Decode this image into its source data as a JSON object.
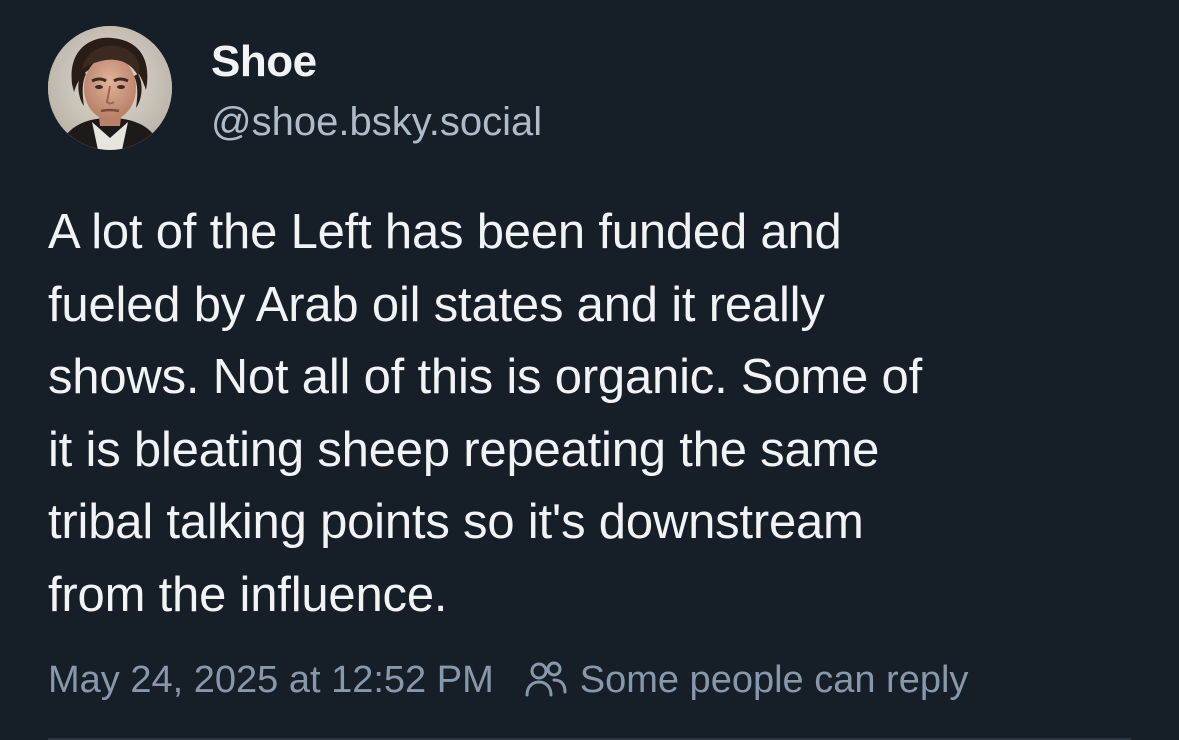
{
  "author": {
    "display_name": "Shoe",
    "handle": "@shoe.bsky.social",
    "avatar_icon": "avatar-portrait-icon"
  },
  "post": {
    "text_lines": [
      "A lot of the Left has been funded and",
      "fueled by Arab oil states and it really",
      "shows. Not all of this is organic. Some of",
      "it is bleating sheep repeating the same",
      "tribal talking points so it's downstream",
      "from the influence."
    ]
  },
  "meta": {
    "timestamp": "May 24, 2025 at 12:52 PM",
    "reply_setting": "Some people can reply",
    "reply_icon": "people-icon"
  },
  "colors": {
    "background": "#161e27",
    "text_primary": "#f1f3f5",
    "text_secondary": "#aebbc9",
    "text_meta": "#8798ab"
  }
}
